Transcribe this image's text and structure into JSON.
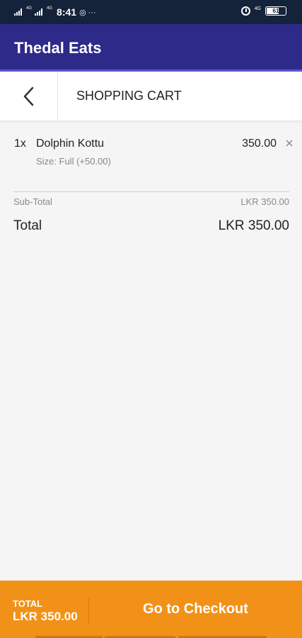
{
  "status_bar": {
    "signal_labels": [
      "4G",
      "4G"
    ],
    "time": "8:41",
    "extra_icons": "%···",
    "network": "4G",
    "battery": "61",
    "battery_level": 0.61
  },
  "app": {
    "title": "Thedal Eats"
  },
  "cart": {
    "title": "SHOPPING CART",
    "items": [
      {
        "qty": "1x",
        "name": "Dolphin Kottu",
        "size": "Size: Full (+50.00)",
        "price": "350.00"
      }
    ],
    "subtotal_label": "Sub-Total",
    "subtotal_value": "LKR 350.00",
    "total_label": "Total",
    "total_value": "LKR 350.00"
  },
  "footer": {
    "total_label": "TOTAL",
    "total_value": "LKR 350.00",
    "checkout_label": "Go to Checkout"
  },
  "colors": {
    "status_bar": "#14223a",
    "app_bar": "#2d2a8a",
    "accent_orange": "#f29118",
    "background": "#f5f5f5"
  },
  "icons": {
    "back": "chevron-left-icon",
    "remove": "close-icon",
    "alarm": "alarm-icon",
    "battery": "battery-icon"
  }
}
